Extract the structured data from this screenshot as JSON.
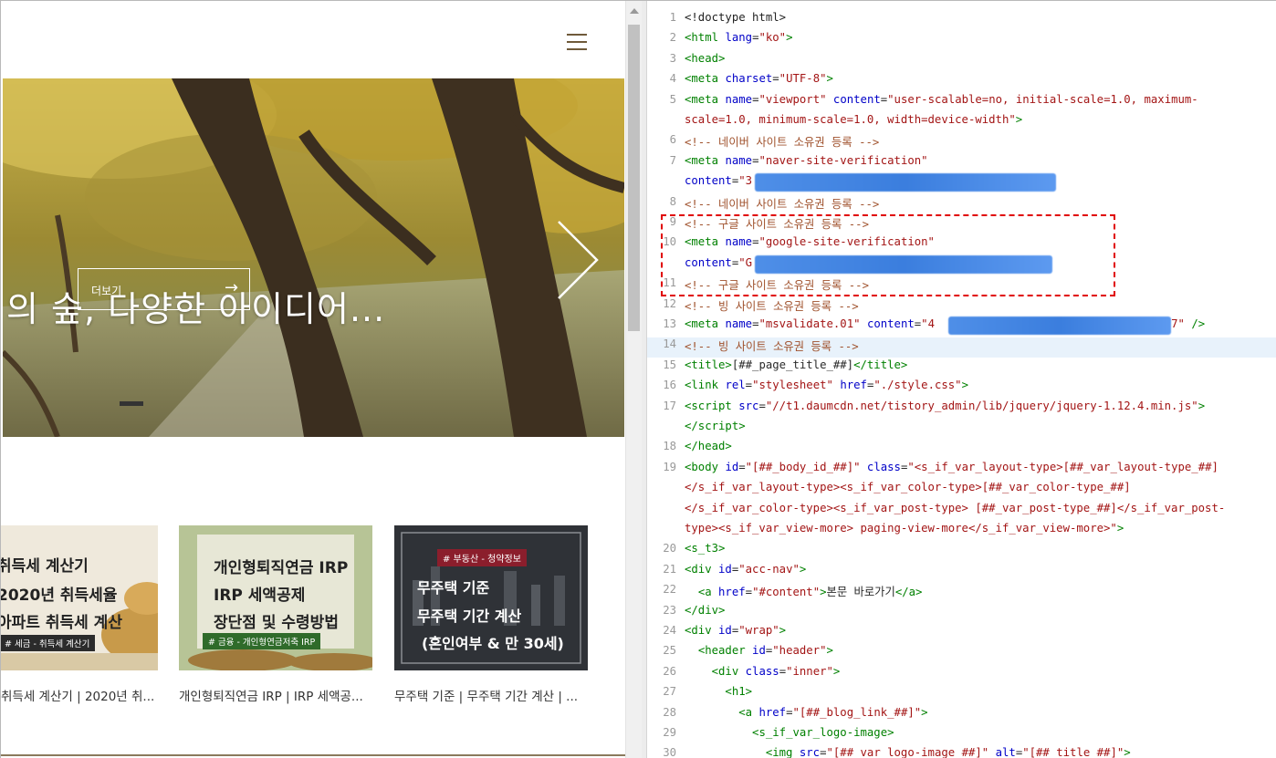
{
  "preview": {
    "menu_icon": "hamburger-icon",
    "hero": {
      "title": "의 숲, 다양한 아이디어...",
      "more_label": "더보기",
      "more_arrow": "→",
      "next_icon": "chevron-right-icon"
    },
    "cards": [
      {
        "lines": [
          "취득세 계산기",
          "2020년 취득세율",
          "아파트 취득세 계산"
        ],
        "tag": "# 세금 - 취득세 계산기",
        "caption": "취득세 계산기 | 2020년 취..."
      },
      {
        "lines": [
          "개인형퇴직연금 IRP",
          "IRP 세액공제",
          "장단점 및 수령방법"
        ],
        "tag": "# 금융 - 개인형연금저축 IRP",
        "caption": "개인형퇴직연금 IRP | IRP 세액공..."
      },
      {
        "lines": [
          "무주택 기준",
          "무주택 기간 계산",
          "(혼인여부 & 만 30세)"
        ],
        "tag": "# 부동산 - 청약정보",
        "caption": "무주택 기준 | 무주택 기간 계산 | ..."
      }
    ]
  },
  "editor": {
    "line_numbers": [
      "1",
      "2",
      "3",
      "4",
      "5",
      "",
      "6",
      "7",
      "",
      "8",
      "9",
      "10",
      "",
      "11",
      "12",
      "13",
      "14",
      "15",
      "16",
      "17",
      "",
      "18",
      "19",
      "",
      "",
      "",
      "20",
      "21",
      "22",
      "23",
      "24",
      "25",
      "26",
      "27",
      "28",
      "29",
      "30"
    ],
    "lines": [
      {
        "n": "1",
        "html": "<span class=\"p\">&lt;!doctype html&gt;</span>"
      },
      {
        "n": "2",
        "html": "<span class=\"t\">&lt;html</span> <span class=\"a\">lang</span>=<span class=\"v\">\"ko\"</span><span class=\"t\">&gt;</span>"
      },
      {
        "n": "3",
        "html": "<span class=\"t\">&lt;head&gt;</span>"
      },
      {
        "n": "4",
        "html": "<span class=\"t\">&lt;meta</span> <span class=\"a\">charset</span>=<span class=\"v\">\"UTF-8\"</span><span class=\"t\">&gt;</span>"
      },
      {
        "n": "5",
        "html": "<span class=\"t\">&lt;meta</span> <span class=\"a\">name</span>=<span class=\"v\">\"viewport\"</span> <span class=\"a\">content</span>=<span class=\"v\">\"user-scalable=no, initial-scale=1.0, maximum-</span>"
      },
      {
        "n": "",
        "html": "<span class=\"v\">scale=1.0, minimum-scale=1.0, width=device-width\"</span><span class=\"t\">&gt;</span>"
      },
      {
        "n": "6",
        "html": "<span class=\"c\">&lt;!-- 네이버 사이트 소유권 등록 --&gt;</span>"
      },
      {
        "n": "7",
        "html": "<span class=\"t\">&lt;meta</span> <span class=\"a\">name</span>=<span class=\"v\">\"naver-site-verification\"</span>"
      },
      {
        "n": "",
        "html": "<span class=\"a\">content</span>=<span class=\"v\">\"3</span>                                   <span class=\"t\">/&gt;</span>"
      },
      {
        "n": "8",
        "html": "<span class=\"c\">&lt;!-- 네이버 사이트 소유권 등록 --&gt;</span>"
      },
      {
        "n": "9",
        "html": "<span class=\"c\">&lt;!-- 구글 사이트 소유권 등록 --&gt;</span>"
      },
      {
        "n": "10",
        "html": "<span class=\"t\">&lt;meta</span> <span class=\"a\">name</span>=<span class=\"v\">\"google-site-verification\"</span>"
      },
      {
        "n": "",
        "html": "<span class=\"a\">content</span>=<span class=\"v\">\"G</span>                                   <span class=\"v\">I\"</span> <span class=\"t\">/&gt;</span>"
      },
      {
        "n": "11",
        "html": "<span class=\"c\">&lt;!-- 구글 사이트 소유권 등록 --&gt;</span>"
      },
      {
        "n": "12",
        "html": "<span class=\"c\">&lt;!-- 빙 사이트 소유권 등록 --&gt;</span>"
      },
      {
        "n": "13",
        "html": "<span class=\"t\">&lt;meta</span> <span class=\"a\">name</span>=<span class=\"v\">\"msvalidate.01\"</span> <span class=\"a\">content</span>=<span class=\"v\">\"4</span>                                   <span class=\"v\">7\"</span> <span class=\"t\">/&gt;</span>"
      },
      {
        "n": "14",
        "html": "<span class=\"c\">&lt;!-- 빙 사이트 소유권 등록 --&gt;</span>"
      },
      {
        "n": "15",
        "html": "<span class=\"t\">&lt;title&gt;</span>[##_page_title_##]<span class=\"t\">&lt;/title&gt;</span>"
      },
      {
        "n": "16",
        "html": "<span class=\"t\">&lt;link</span> <span class=\"a\">rel</span>=<span class=\"v\">\"stylesheet\"</span> <span class=\"a\">href</span>=<span class=\"v\">\"./style.css\"</span><span class=\"t\">&gt;</span>"
      },
      {
        "n": "17",
        "html": "<span class=\"t\">&lt;script</span> <span class=\"a\">src</span>=<span class=\"v\">\"//t1.daumcdn.net/tistory_admin/lib/jquery/jquery-1.12.4.min.js\"</span><span class=\"t\">&gt;</span>"
      },
      {
        "n": "",
        "html": "<span class=\"t\">&lt;/script&gt;</span>"
      },
      {
        "n": "18",
        "html": "<span class=\"t\">&lt;/head&gt;</span>"
      },
      {
        "n": "19",
        "html": "<span class=\"t\">&lt;body</span> <span class=\"a\">id</span>=<span class=\"v\">\"[##_body_id_##]\"</span> <span class=\"a\">class</span>=<span class=\"v\">\"&lt;s_if_var_layout-type&gt;[##_var_layout-type_##]</span>"
      },
      {
        "n": "",
        "html": "<span class=\"v\">&lt;/s_if_var_layout-type&gt;&lt;s_if_var_color-type&gt;[##_var_color-type_##]</span>"
      },
      {
        "n": "",
        "html": "<span class=\"v\">&lt;/s_if_var_color-type&gt;&lt;s_if_var_post-type&gt; [##_var_post-type_##]&lt;/s_if_var_post-</span>"
      },
      {
        "n": "",
        "html": "<span class=\"v\">type&gt;&lt;s_if_var_view-more&gt; paging-view-more&lt;/s_if_var_view-more&gt;\"</span><span class=\"t\">&gt;</span>"
      },
      {
        "n": "20",
        "html": "<span class=\"t\">&lt;s_t3&gt;</span>"
      },
      {
        "n": "21",
        "html": "<span class=\"t\">&lt;div</span> <span class=\"a\">id</span>=<span class=\"v\">\"acc-nav\"</span><span class=\"t\">&gt;</span>"
      },
      {
        "n": "22",
        "html": "  <span class=\"t\">&lt;a</span> <span class=\"a\">href</span>=<span class=\"v\">\"#content\"</span><span class=\"t\">&gt;</span>본문 바로가기<span class=\"t\">&lt;/a&gt;</span>"
      },
      {
        "n": "23",
        "html": "<span class=\"t\">&lt;/div&gt;</span>"
      },
      {
        "n": "24",
        "html": "<span class=\"t\">&lt;div</span> <span class=\"a\">id</span>=<span class=\"v\">\"wrap\"</span><span class=\"t\">&gt;</span>"
      },
      {
        "n": "25",
        "html": "  <span class=\"t\">&lt;header</span> <span class=\"a\">id</span>=<span class=\"v\">\"header\"</span><span class=\"t\">&gt;</span>"
      },
      {
        "n": "26",
        "html": "    <span class=\"t\">&lt;div</span> <span class=\"a\">class</span>=<span class=\"v\">\"inner\"</span><span class=\"t\">&gt;</span>"
      },
      {
        "n": "27",
        "html": "      <span class=\"t\">&lt;h1&gt;</span>"
      },
      {
        "n": "28",
        "html": "        <span class=\"t\">&lt;a</span> <span class=\"a\">href</span>=<span class=\"v\">\"[##_blog_link_##]\"</span><span class=\"t\">&gt;</span>"
      },
      {
        "n": "29",
        "html": "          <span class=\"t\">&lt;s_if_var_logo-image&gt;</span>"
      },
      {
        "n": "30",
        "html": "            <span class=\"t\">&lt;img</span> <span class=\"a\">src</span>=<span class=\"v\">\"[##_var_logo-image_##]\"</span> <span class=\"a\">alt</span>=<span class=\"v\">\"[##_title_##]\"</span><span class=\"t\">&gt;</span>"
      }
    ]
  }
}
